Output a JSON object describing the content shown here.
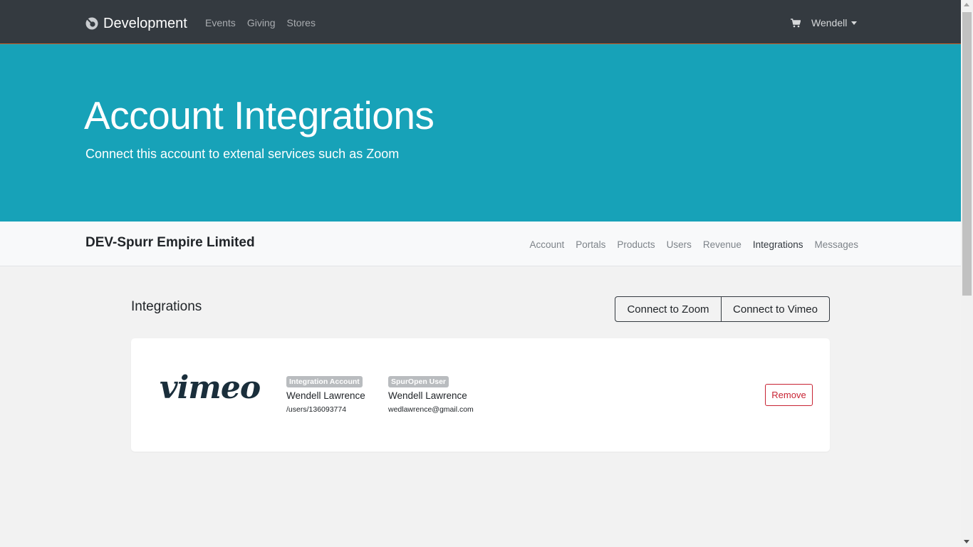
{
  "navbar": {
    "brand": "Development",
    "links": [
      "Events",
      "Giving",
      "Stores"
    ],
    "user": "Wendell"
  },
  "hero": {
    "title": "Account Integrations",
    "subtitle": "Connect this account to extenal services such as Zoom"
  },
  "subnav": {
    "org_name": "DEV-Spurr Empire Limited",
    "links": [
      "Account",
      "Portals",
      "Products",
      "Users",
      "Revenue",
      "Integrations",
      "Messages"
    ],
    "active": "Integrations"
  },
  "main": {
    "section_title": "Integrations",
    "connect_zoom_label": "Connect to Zoom",
    "connect_vimeo_label": "Connect to Vimeo",
    "integration": {
      "logo_text": "vimeo",
      "account_badge": "Integration Account",
      "account_name": "Wendell Lawrence",
      "account_path": "/users/136093774",
      "user_badge": "SpurOpen User",
      "user_name": "Wendell Lawrence",
      "user_email": "wedlawrence@gmail.com",
      "remove_label": "Remove"
    }
  },
  "colors": {
    "navbar": "#343a40",
    "hero": "#17a2b8",
    "danger": "#c82333"
  }
}
